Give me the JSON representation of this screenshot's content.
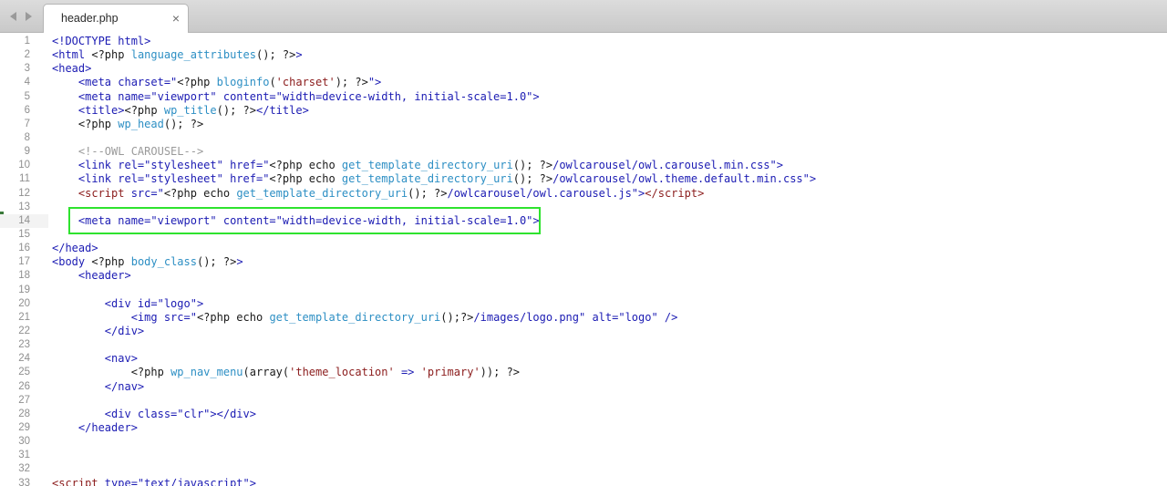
{
  "tab": {
    "title": "header.php",
    "close_glyph": "×"
  },
  "nav": {
    "back_icon": "chevron-left-icon",
    "forward_icon": "chevron-right-icon"
  },
  "colors": {
    "tag": "#1b1bb3",
    "string": "#8b1c1c",
    "function": "#2d8fc4",
    "comment": "#9a9a9a",
    "highlight_border": "#2ee32e",
    "line_number": "#8f8f8f"
  },
  "editor": {
    "current_line": 14,
    "lines": [
      {
        "n": "1",
        "html": "<span class=\"t\">&lt;!DOCTYPE html&gt;</span>"
      },
      {
        "n": "2",
        "html": "<span class=\"t\">&lt;html </span><span class=\"p\">&lt;?php </span><span class=\"f\">language_attributes</span><span class=\"p\">(); ?&gt;</span><span class=\"t\">&gt;</span>"
      },
      {
        "n": "3",
        "html": "<span class=\"t\">&lt;head&gt;</span>"
      },
      {
        "n": "4",
        "html": "    <span class=\"t\">&lt;meta charset=\"</span><span class=\"p\">&lt;?php </span><span class=\"f\">bloginfo</span><span class=\"p\">(</span><span class=\"ks\">'charset'</span><span class=\"p\">); ?&gt;</span><span class=\"t\">\"&gt;</span>"
      },
      {
        "n": "5",
        "html": "    <span class=\"t\">&lt;meta name=\"viewport\" content=\"width=device-width, initial-scale=1.0\"&gt;</span>"
      },
      {
        "n": "6",
        "html": "    <span class=\"t\">&lt;title&gt;</span><span class=\"p\">&lt;?php </span><span class=\"f\">wp_title</span><span class=\"p\">(); ?&gt;</span><span class=\"t\">&lt;/title&gt;</span>"
      },
      {
        "n": "7",
        "html": "    <span class=\"p\">&lt;?php </span><span class=\"f\">wp_head</span><span class=\"p\">(); ?&gt;</span>"
      },
      {
        "n": "8",
        "html": ""
      },
      {
        "n": "9",
        "html": "    <span class=\"c\">&lt;!--OWL CAROUSEL--&gt;</span>"
      },
      {
        "n": "10",
        "html": "    <span class=\"t\">&lt;link rel=\"stylesheet\" href=\"</span><span class=\"p\">&lt;?php echo </span><span class=\"f\">get_template_directory_uri</span><span class=\"p\">(); ?&gt;</span><span class=\"t\">/owlcarousel/owl.carousel.min.css\"&gt;</span>"
      },
      {
        "n": "11",
        "html": "    <span class=\"t\">&lt;link rel=\"stylesheet\" href=\"</span><span class=\"p\">&lt;?php echo </span><span class=\"f\">get_template_directory_uri</span><span class=\"p\">(); ?&gt;</span><span class=\"t\">/owlcarousel/owl.theme.default.min.css\"&gt;</span>"
      },
      {
        "n": "12",
        "html": "    <span class=\"s\">&lt;script </span><span class=\"t\">src=\"</span><span class=\"p\">&lt;?php echo </span><span class=\"f\">get_template_directory_uri</span><span class=\"p\">(); ?&gt;</span><span class=\"t\">/owlcarousel/owl.carousel.js\"&gt;</span><span class=\"s\">&lt;/script&gt;</span>"
      },
      {
        "n": "13",
        "html": ""
      },
      {
        "n": "14",
        "html": "    <span class=\"t\">&lt;meta name=\"viewport\" content=\"width=device-width, initial-scale=1.0\"&gt;</span><span class=\"cursor\"></span>"
      },
      {
        "n": "15",
        "html": ""
      },
      {
        "n": "16",
        "html": "<span class=\"t\">&lt;/head&gt;</span>"
      },
      {
        "n": "17",
        "html": "<span class=\"t\">&lt;body </span><span class=\"p\">&lt;?php </span><span class=\"f\">body_class</span><span class=\"p\">(); ?&gt;</span><span class=\"t\">&gt;</span>"
      },
      {
        "n": "18",
        "html": "    <span class=\"t\">&lt;header&gt;</span>"
      },
      {
        "n": "19",
        "html": ""
      },
      {
        "n": "20",
        "html": "        <span class=\"t\">&lt;div id=\"logo\"&gt;</span>"
      },
      {
        "n": "21",
        "html": "            <span class=\"t\">&lt;img src=\"</span><span class=\"p\">&lt;?php echo </span><span class=\"f\">get_template_directory_uri</span><span class=\"p\">();?&gt;</span><span class=\"t\">/images/logo.png\" alt=\"logo\" /&gt;</span>"
      },
      {
        "n": "22",
        "html": "        <span class=\"t\">&lt;/div&gt;</span>"
      },
      {
        "n": "23",
        "html": ""
      },
      {
        "n": "24",
        "html": "        <span class=\"t\">&lt;nav&gt;</span>"
      },
      {
        "n": "25",
        "html": "            <span class=\"p\">&lt;?php </span><span class=\"f\">wp_nav_menu</span><span class=\"p\">(array(</span><span class=\"ks\">'theme_location'</span><span class=\"p\"> </span><span class=\"t\">=&gt;</span><span class=\"p\"> </span><span class=\"ks\">'primary'</span><span class=\"p\">)); ?&gt;</span>"
      },
      {
        "n": "26",
        "html": "        <span class=\"t\">&lt;/nav&gt;</span>"
      },
      {
        "n": "27",
        "html": ""
      },
      {
        "n": "28",
        "html": "        <span class=\"t\">&lt;div class=\"clr\"&gt;&lt;/div&gt;</span>"
      },
      {
        "n": "29",
        "html": "    <span class=\"t\">&lt;/header&gt;</span>"
      },
      {
        "n": "30",
        "html": ""
      },
      {
        "n": "31",
        "html": ""
      },
      {
        "n": "32",
        "html": ""
      },
      {
        "n": "33",
        "html": "<span class=\"s\">&lt;script </span><span class=\"t\">type=\"text/javascript\"&gt;</span>"
      }
    ]
  }
}
